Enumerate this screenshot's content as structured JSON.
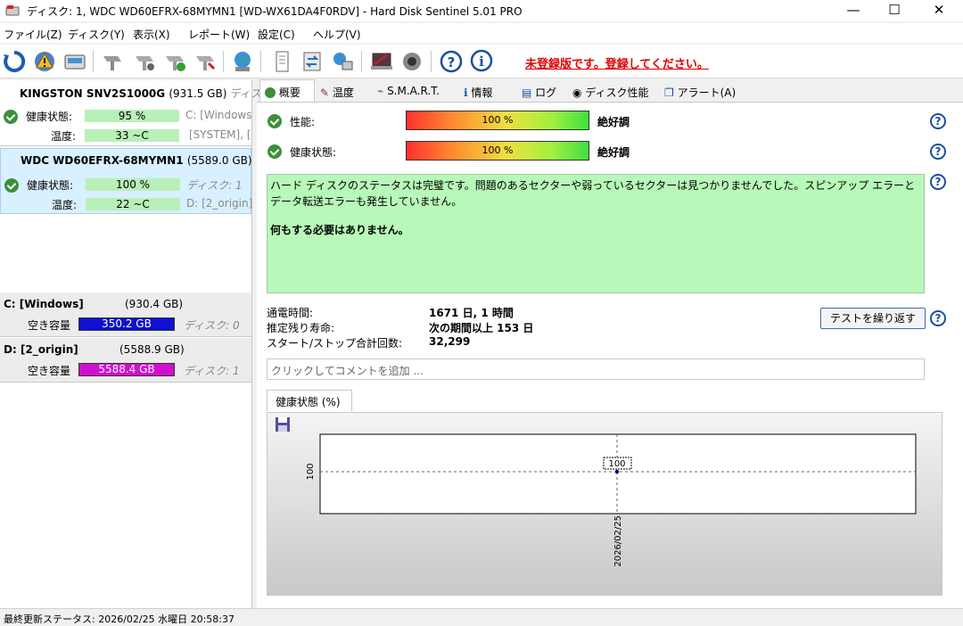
{
  "window": {
    "title": "ディスク: 1, WDC WD60EFRX-68MYMN1 [WD-WX61DA4F0RDV]  -  Hard Disk Sentinel 5.01 PRO",
    "minimize": "—",
    "maximize": "☐",
    "close": "✕"
  },
  "menu": [
    "ファイル(Z)",
    "ディスク(Y)",
    "表示(X)",
    "レポート(W)",
    "設定(C)",
    "ヘルプ(V)"
  ],
  "toolbar": {
    "unregistered_text": "未登録版です。登録してください。",
    "icons": [
      "refresh-icon",
      "alert-icon",
      "drive-icon",
      "drive-gray-icon",
      "drive-mount-icon",
      "drive-check-icon",
      "drive-tools-icon",
      "globe-icon",
      "report-icon",
      "exchange-icon",
      "network-icon",
      "notebook-icon",
      "speaker-icon",
      "help-icon",
      "info-icon"
    ]
  },
  "disks": [
    {
      "name": "KINGSTON SNV2S1000G",
      "size": "(931.5 GB)",
      "label": "ディスク",
      "health_label": "健康状態:",
      "health_value": "95 %",
      "health_pct": 95,
      "temp_label": "温度:",
      "temp_value": "33 ~C",
      "vol1": "C: [Windows",
      "vol2": "[SYSTEM], ["
    },
    {
      "name": "WDC WD60EFRX-68MYMN1",
      "size": "(5589.0 GB)",
      "health_label": "健康状態:",
      "health_value": "100 %",
      "health_pct": 100,
      "temp_label": "温度:",
      "temp_value": "22 ~C",
      "vol1": "ディスク: 1",
      "vol2": "D: [2_origin]"
    }
  ],
  "volumes": [
    {
      "name": "C: [Windows]",
      "size": "(930.4 GB)",
      "free_label": "空き容量",
      "free": "350.2 GB",
      "disk": "ディスク: 0",
      "color": "#1010d0",
      "free_pct": 37.6
    },
    {
      "name": "D: [2_origin]",
      "size": "(5588.9 GB)",
      "free_label": "空き容量",
      "free": "5588.4 GB",
      "disk": "ディスク: 1",
      "color": "#d010d0",
      "free_pct": 99.9
    }
  ],
  "tabs": [
    "概要",
    "温度",
    "S.M.A.R.T.",
    "情報",
    "ログ",
    "ディスク性能",
    "アラート(A)"
  ],
  "overview": {
    "performance_label": "性能:",
    "performance_value": "100 %",
    "performance_pct": 100,
    "performance_status": "絶好調",
    "health_label": "健康状態:",
    "health_value": "100 %",
    "health_pct": 100,
    "health_status": "絶好調",
    "status_text": "ハード ディスクのステータスは完璧です。問題のあるセクターや弱っているセクターは見つかりませんでした。スピンアップ エラーとデータ転送エラーも発生していません。",
    "status_action": "何もする必要はありません。",
    "power_on_label": "通電時間:",
    "power_on_value": "1671 日, 1 時間",
    "lifetime_label": "推定残り寿命:",
    "lifetime_value": "次の期間以上 153 日",
    "startstop_label": "スタート/ストップ合計回数:",
    "startstop_value": "32,299",
    "retest_button": "テストを繰り返す",
    "comment_placeholder": "クリックしてコメントを追加 ...",
    "chart_tab": "健康状態 (%)"
  },
  "chart_data": {
    "type": "line",
    "x": [
      "2026/02/25"
    ],
    "series": [
      {
        "values": [
          100
        ]
      }
    ],
    "ylabel": "",
    "ytick": "100",
    "data_label": "100"
  },
  "statusbar": {
    "text": "最終更新ステータス: 2026/02/25 水曜日 20:58:37"
  }
}
